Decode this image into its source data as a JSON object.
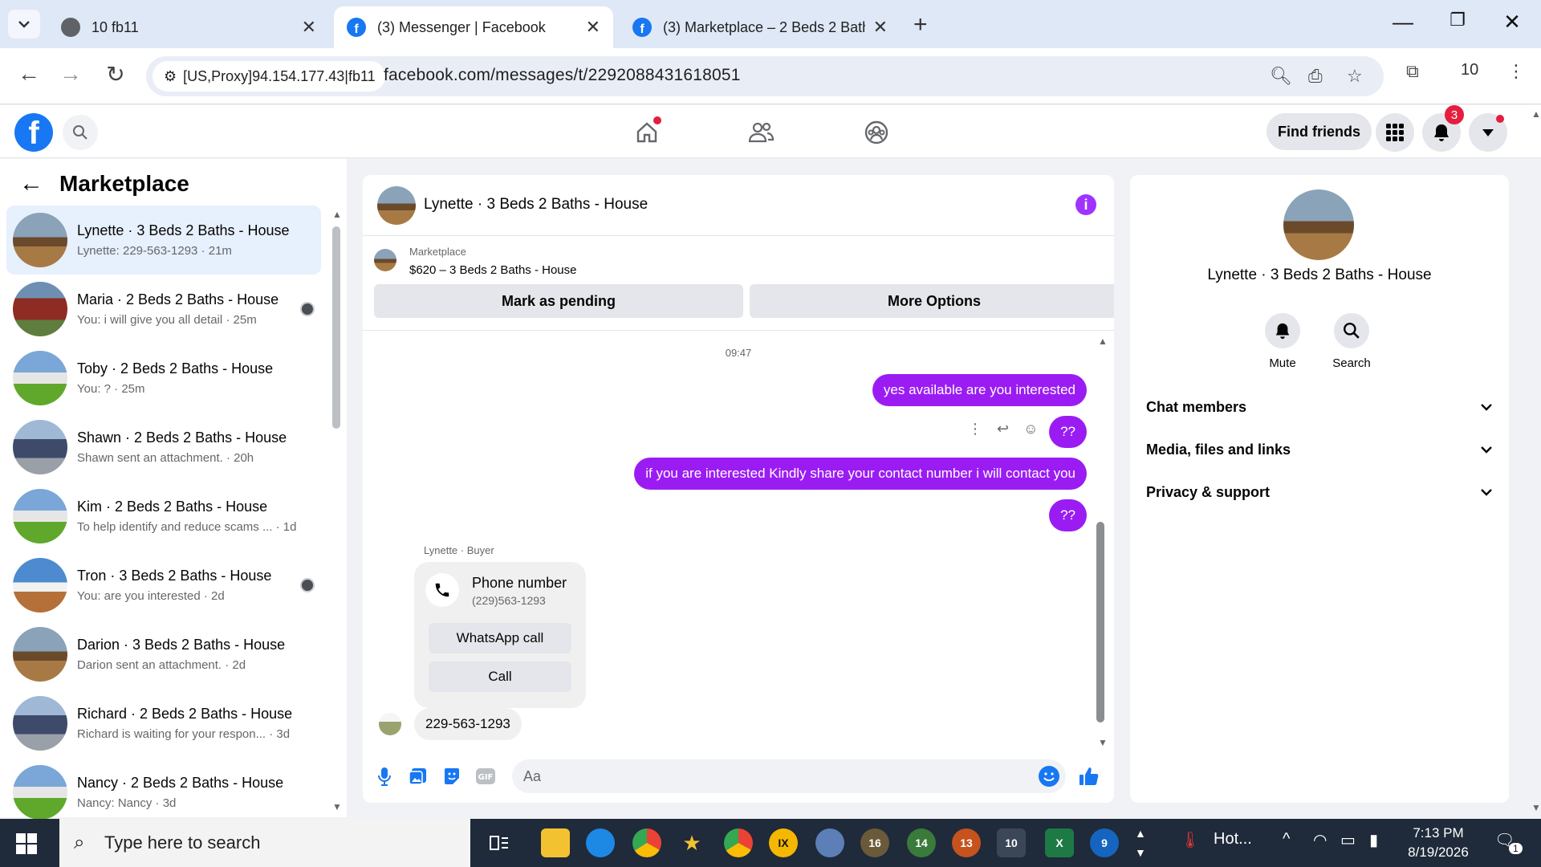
{
  "browser": {
    "tabs": [
      {
        "title": "10 fb11",
        "active": false
      },
      {
        "title": "(3) Messenger | Facebook",
        "active": true
      },
      {
        "title": "(3) Marketplace – 2 Beds 2 Bath",
        "active": false
      }
    ],
    "proxy_label": "[US,Proxy]94.154.177.43|fb11",
    "url": "facebook.com/messages/t/2292088431618051",
    "profile_count": "10"
  },
  "fb_header": {
    "find_friends": "Find friends",
    "notification_count": "3"
  },
  "left": {
    "title": "Marketplace",
    "conversations": [
      {
        "name": "Lynette · 3 Beds 2 Baths - House",
        "preview": "Lynette: 229-563-1293 · 21m",
        "selected": true
      },
      {
        "name": "Maria · 2 Beds 2 Baths - House",
        "preview": "You: i will give you all detail · 25m",
        "selected": false
      },
      {
        "name": "Toby · 2 Beds 2 Baths - House",
        "preview": "You: ? · 25m",
        "selected": false
      },
      {
        "name": "Shawn · 2 Beds 2 Baths - House",
        "preview": "Shawn sent an attachment. · 20h",
        "selected": false
      },
      {
        "name": "Kim · 2 Beds 2 Baths - House",
        "preview": "To help identify and reduce scams ... · 1d",
        "selected": false
      },
      {
        "name": "Tron · 3 Beds 2 Baths - House",
        "preview": "You: are you interested · 2d",
        "selected": false
      },
      {
        "name": "Darion · 3 Beds 2 Baths - House",
        "preview": "Darion sent an attachment. · 2d",
        "selected": false
      },
      {
        "name": "Richard · 2 Beds 2 Baths - House",
        "preview": "Richard is waiting for your respon... · 3d",
        "selected": false
      },
      {
        "name": "Nancy · 2 Beds 2 Baths - House",
        "preview": "Nancy: Nancy · 3d",
        "selected": false
      }
    ]
  },
  "chat": {
    "title": "Lynette · 3 Beds 2 Baths - House",
    "marketplace_label": "Marketplace",
    "listing": "$620 – 3 Beds 2 Baths - House",
    "mark_pending": "Mark as pending",
    "more_options": "More Options",
    "timestamp": "09:47",
    "outgoing": [
      "yes available are you interested",
      "??",
      "if you are interested Kindly  share your contact  number i will contact you",
      "??"
    ],
    "sender_label": "Lynette · Buyer",
    "phone_card": {
      "title": "Phone number",
      "number": "(229)563-1293",
      "whatsapp": "WhatsApp call",
      "call": "Call"
    },
    "incoming_text": "229-563-1293",
    "input_placeholder": "Aa"
  },
  "right": {
    "name": "Lynette · 3 Beds 2 Baths - House",
    "mute": "Mute",
    "search": "Search",
    "sections": [
      "Chat members",
      "Media, files and links",
      "Privacy & support"
    ]
  },
  "taskbar": {
    "search_placeholder": "Type here to search",
    "badges": [
      "16",
      "14",
      "13",
      "10",
      "9"
    ],
    "weather": "Hot...",
    "time": "7:13 PM",
    "date": "8/19/2026",
    "notifications": "1"
  },
  "colors": {
    "messenger_purple": "#9b1cf3",
    "facebook_blue": "#1877f2",
    "selected_row": "#e7f0fd"
  }
}
